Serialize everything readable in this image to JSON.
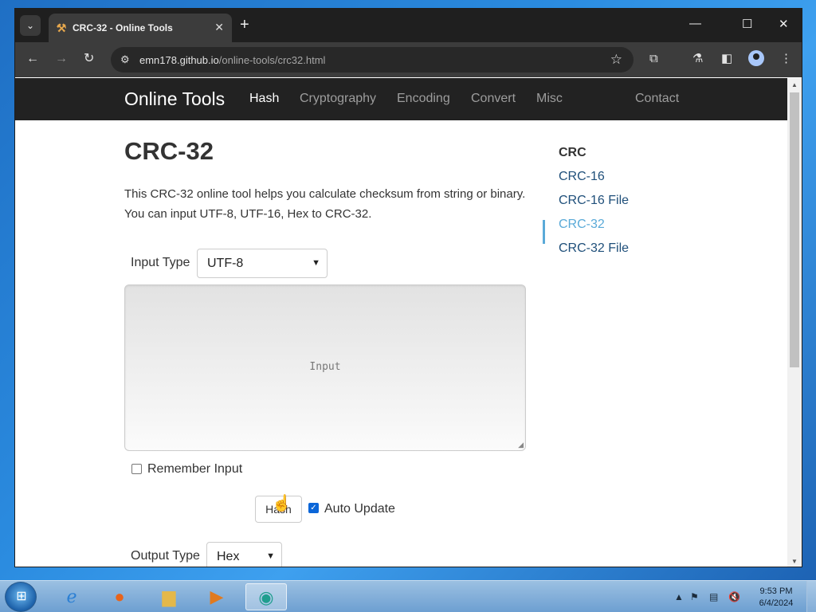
{
  "browser": {
    "tab": {
      "title": "CRC-32 - Online Tools",
      "favicon": "hammer-icon",
      "close": "✕"
    },
    "new_tab": "+",
    "window_controls": {
      "minimize": "—",
      "maximize": "☐",
      "close": "✕"
    },
    "address": {
      "host": "emn178.github.io",
      "path": "/online-tools/crc32.html"
    }
  },
  "site": {
    "brand": "Online Tools",
    "nav": [
      "Hash",
      "Cryptography",
      "Encoding",
      "Convert",
      "Misc"
    ],
    "nav_active": "Hash",
    "contact": "Contact"
  },
  "page": {
    "title": "CRC-32",
    "description": "This CRC-32 online tool helps you calculate checksum from string or binary. You can input UTF-8, UTF-16, Hex to CRC-32.",
    "input_type_label": "Input Type",
    "input_type_value": "UTF-8",
    "input_placeholder": "Input",
    "remember_input_label": "Remember Input",
    "remember_input_checked": false,
    "hash_button": "Hash",
    "auto_update_label": "Auto Update",
    "auto_update_checked": true,
    "output_type_label": "Output Type",
    "output_type_value": "Hex"
  },
  "sidebar": {
    "heading": "CRC",
    "items": [
      "CRC-16",
      "CRC-16 File",
      "CRC-32",
      "CRC-32 File"
    ],
    "active": "CRC-32"
  },
  "taskbar": {
    "apps": [
      "internet-explorer-icon",
      "firefox-icon",
      "file-explorer-icon",
      "media-player-icon",
      "active-app-icon"
    ],
    "clock_time": "9:53 PM",
    "clock_date": "6/4/2024"
  },
  "colors": {
    "navbar_bg": "#222222",
    "sidebar_active": "#5aaad8",
    "link": "#1f4f7a",
    "checkbox_on": "#0b66d8"
  }
}
